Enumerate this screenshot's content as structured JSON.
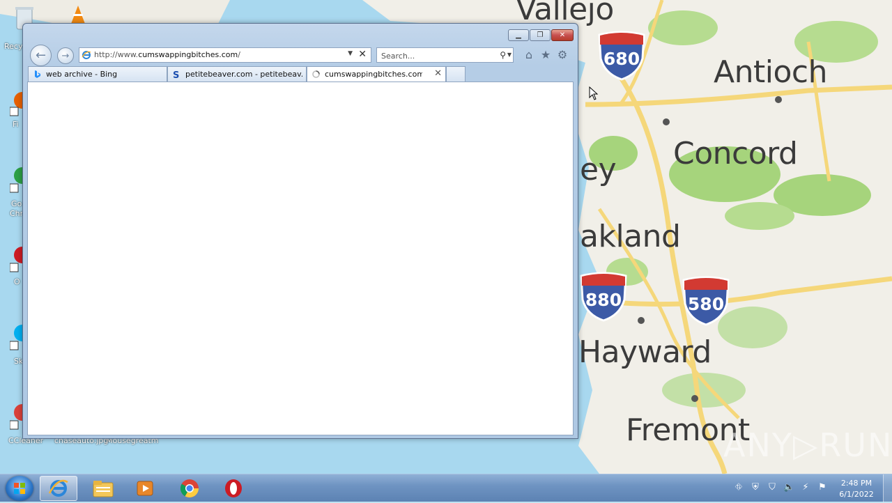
{
  "desktop": {
    "map_labels": [
      "Vallejo",
      "Antioch",
      "Concord",
      "ey",
      "akland",
      "Hayward",
      "Fremont"
    ],
    "highway_shields": [
      "680",
      "880",
      "580"
    ],
    "watermark": "ANY▷RUN",
    "icon_labels": [
      "Recy",
      "Fi",
      "Go",
      "Chr",
      "O",
      "Sk",
      "CCleaner",
      "chaseauto.jpg",
      "Mousegreatm"
    ]
  },
  "browser": {
    "address": {
      "prefix": "http://www.",
      "domain": "cumswappingbitches.com",
      "suffix": "/"
    },
    "search": {
      "placeholder": "Search..."
    },
    "tabs": [
      {
        "label": "web archive - Bing",
        "icon": "bing-icon"
      },
      {
        "label": "petitebeaver.com - petitebeav...",
        "icon": "s-site-icon"
      },
      {
        "label": "cumswappingbitches.com",
        "icon": "loading-spinner-icon",
        "active": true
      }
    ]
  },
  "taskbar": {
    "apps": [
      "internet-explorer",
      "file-explorer",
      "media-player",
      "chrome",
      "opera"
    ],
    "clock": {
      "time": "2:48 PM",
      "date": "6/1/2022"
    }
  },
  "colors": {
    "map_water": "#a8d8ef",
    "map_land": "#f1efe8",
    "map_green": "#a6d47c",
    "map_road": "#f5d77a",
    "shield_blue": "#3c5aa6",
    "shield_red": "#d23a32"
  }
}
